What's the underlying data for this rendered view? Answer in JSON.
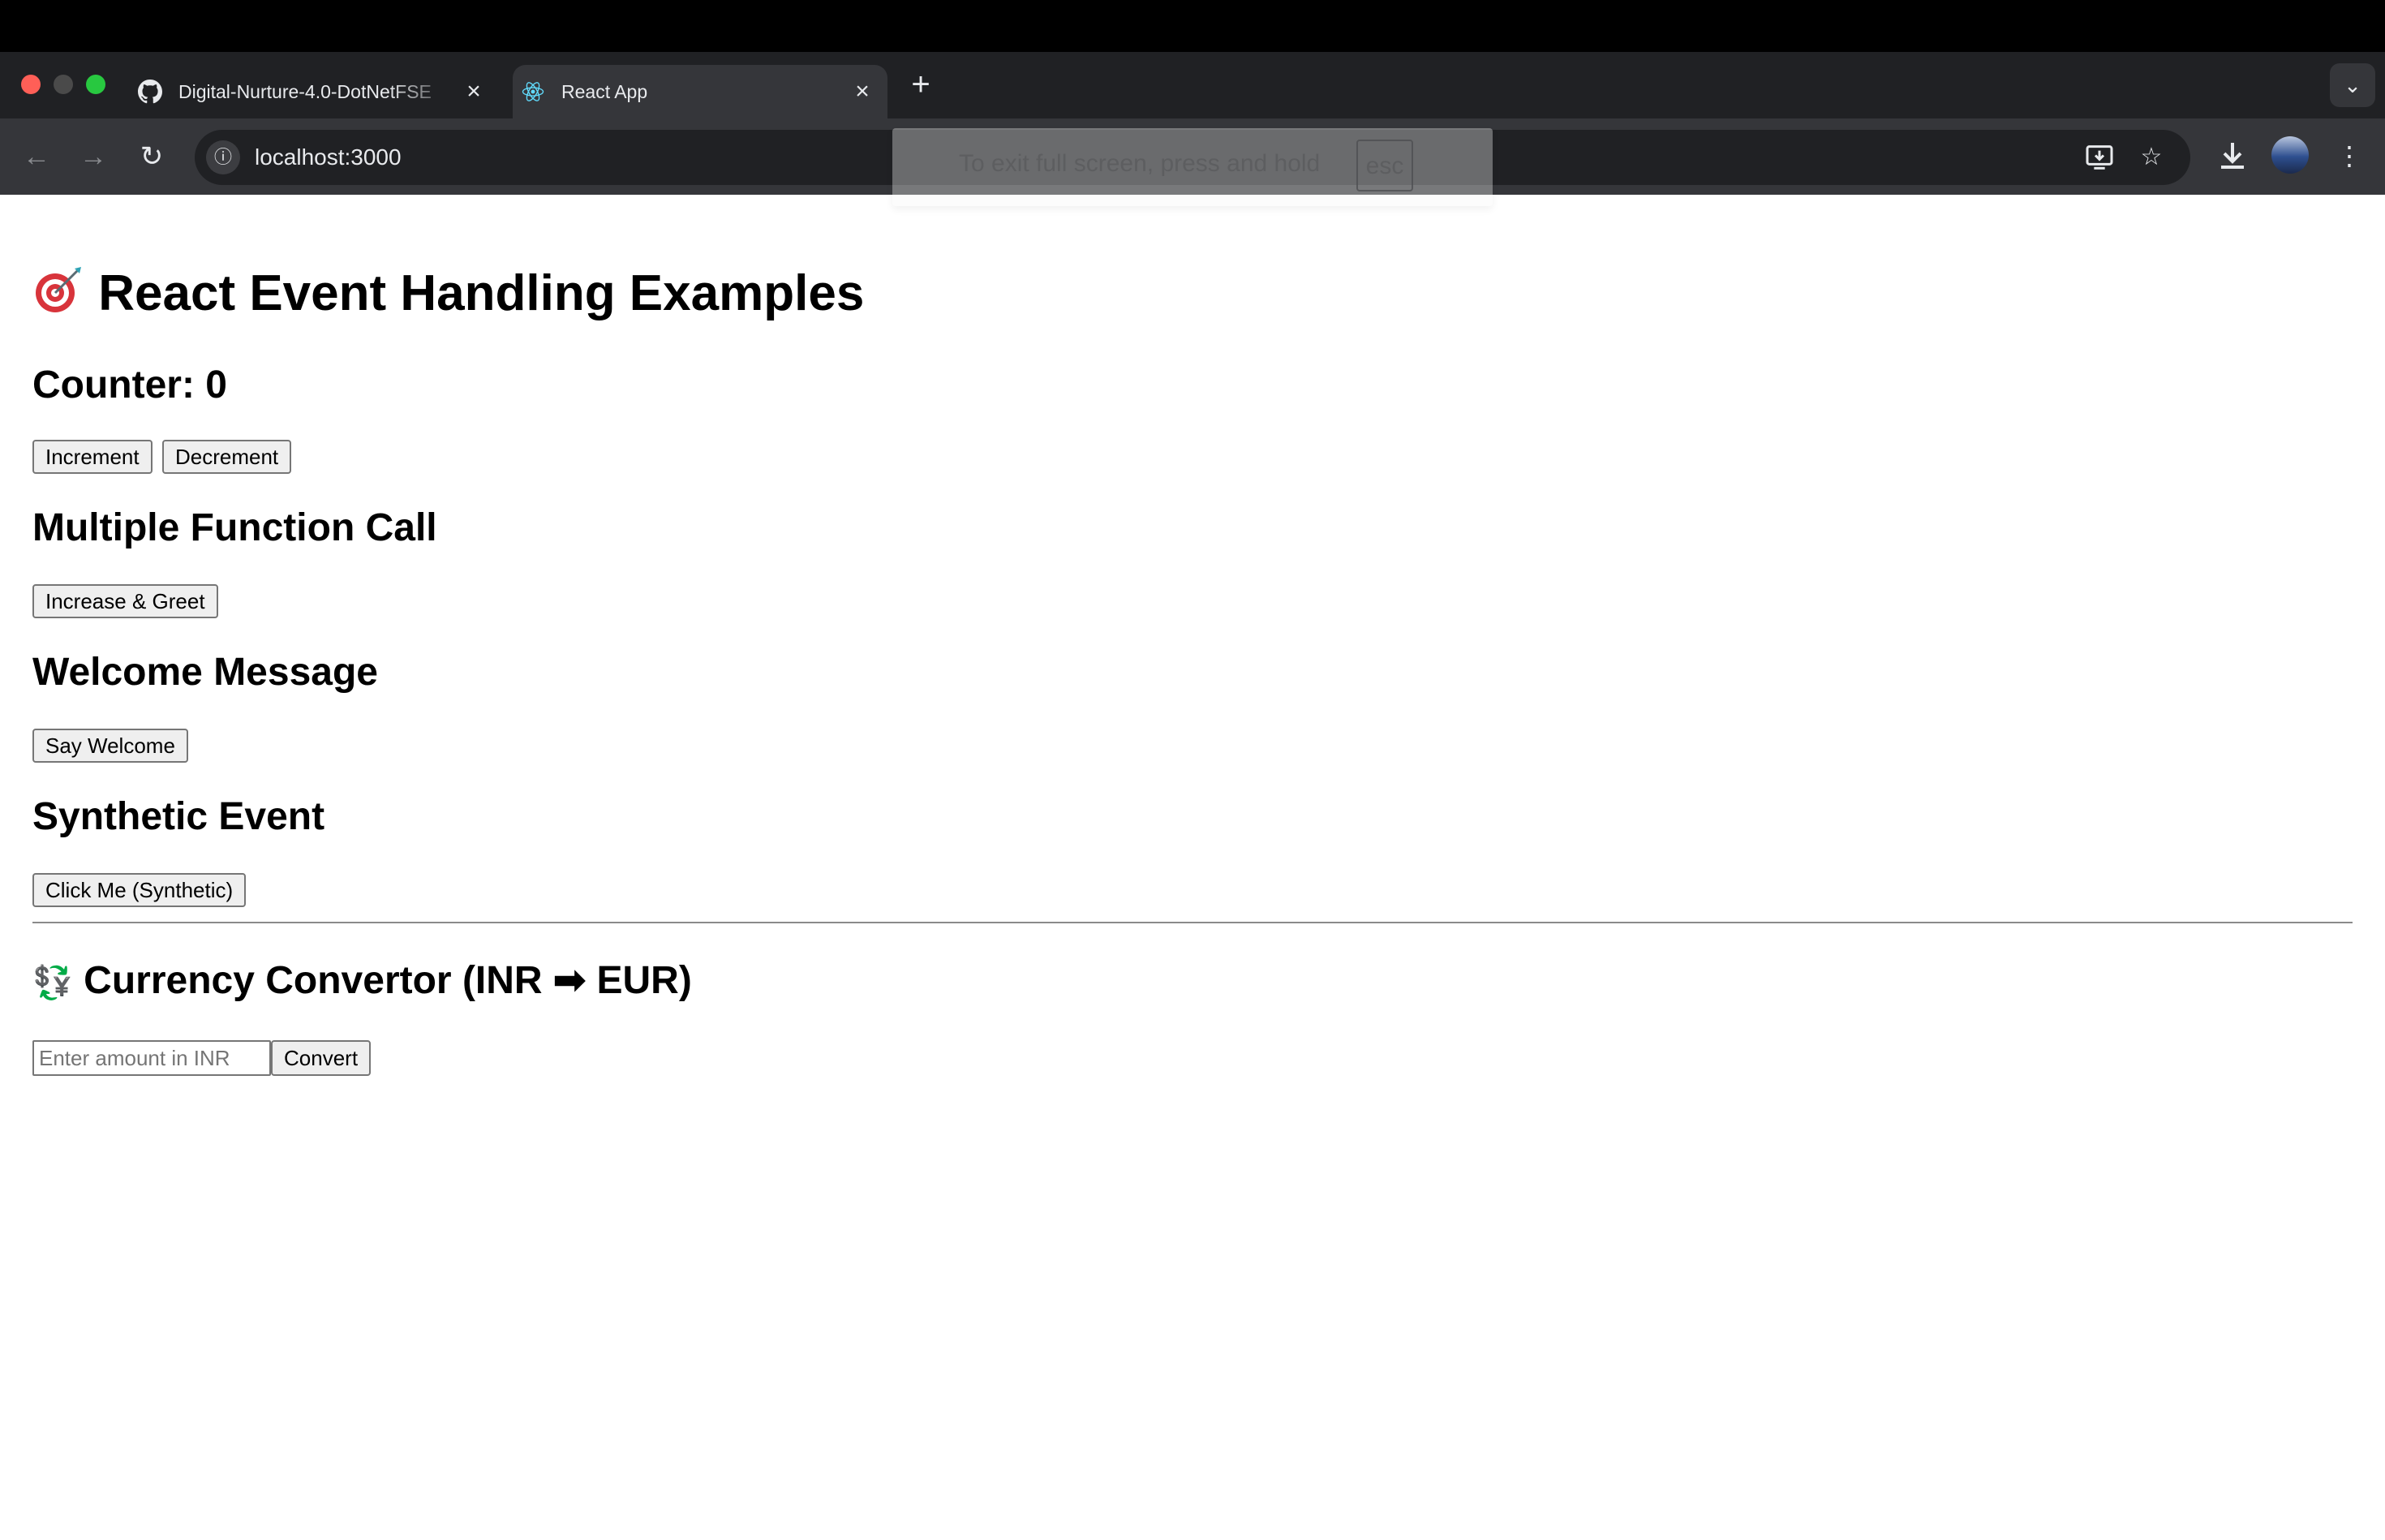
{
  "browser": {
    "tabs": [
      {
        "title": "Digital-Nurture-4.0-DotNetFSE",
        "icon": "github-icon"
      },
      {
        "title": "React App",
        "icon": "react-icon",
        "active": true
      }
    ],
    "url": "localhost:3000",
    "fullscreen_toast": {
      "text": "To exit full screen, press and hold",
      "key": "esc"
    }
  },
  "page": {
    "title": "React Event Handling Examples",
    "title_emoji": "🎯",
    "counter": {
      "heading": "Counter: 0",
      "increment_label": "Increment",
      "decrement_label": "Decrement"
    },
    "multiple": {
      "heading": "Multiple Function Call",
      "button_label": "Increase & Greet"
    },
    "welcome": {
      "heading": "Welcome Message",
      "button_label": "Say Welcome"
    },
    "synthetic": {
      "heading": "Synthetic Event",
      "button_label": "Click Me (Synthetic)"
    },
    "currency": {
      "heading": "Currency Convertor (INR ➡ EUR)",
      "heading_emoji": "💱",
      "input_placeholder": "Enter amount in INR",
      "input_value": "",
      "button_label": "Convert"
    }
  }
}
